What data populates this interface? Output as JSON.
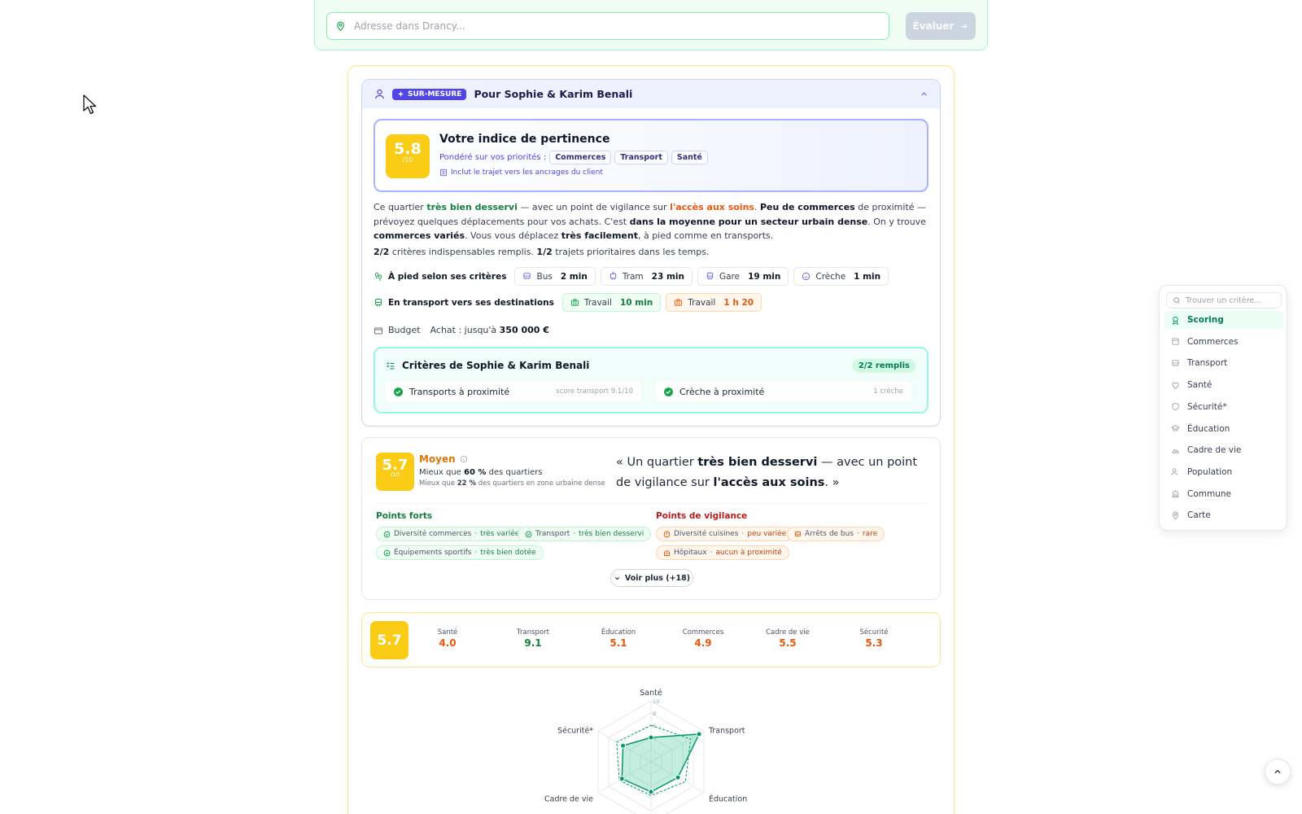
{
  "search": {
    "placeholder": "Adresse dans Drancy...",
    "button_label": "Évaluer"
  },
  "profile": {
    "badge": "SUR-MESURE",
    "title": "Pour Sophie & Karim Benali",
    "score": "5.8",
    "score_max": "/10",
    "index_title": "Votre indice de pertinence",
    "priorities_label": "Pondéré sur vos priorités :",
    "priorities": [
      "Commerces",
      "Transport",
      "Santé"
    ],
    "note": "Inclut le trajet vers les ancrages du client",
    "summary": {
      "p1": "Ce quartier ",
      "b1": "très bien desservi",
      "p2": " — avec un point de vigilance sur ",
      "b2": "l'accès aux soins",
      "p3": ". ",
      "b3": "Peu de commerces",
      "p4": " de proximité — prévoyez quelques déplacements pour vos achats. C'est ",
      "b4": "dans la moyenne pour un secteur urbain dense",
      "p5": ". On y trouve ",
      "b5": "commerces variés",
      "p6": ". Vous vous déplacez ",
      "b6": "très facilement",
      "p7": ", à pied comme en transports."
    },
    "criteria_line": {
      "b1": "2/2",
      "t1": " critères indispensables remplis. ",
      "b2": "1/2",
      "t2": " trajets prioritaires dans les temps."
    },
    "walk_label": "À pied selon ses critères",
    "walk": [
      {
        "icon": "bus-icon",
        "label": "Bus",
        "value": "2 min"
      },
      {
        "icon": "tram-icon",
        "label": "Tram",
        "value": "23 min"
      },
      {
        "icon": "train-icon",
        "label": "Gare",
        "value": "19 min"
      },
      {
        "icon": "baby-icon",
        "label": "Crèche",
        "value": "1 min"
      }
    ],
    "transit_label": "En transport vers ses destinations",
    "transit": [
      {
        "label": "Travail",
        "value": "10 min",
        "status": "green"
      },
      {
        "label": "Travail",
        "value": "1 h 20",
        "status": "orange"
      }
    ],
    "budget_label": "Budget",
    "budget_text": "Achat : jusqu'à ",
    "budget_value": "350 000 €",
    "criteria_title": "Critères de Sophie & Karim Benali",
    "criteria_badge": "2/2 remplis",
    "criteria": [
      {
        "label": "Transports à proximité",
        "meta": "score transport 9.1/10"
      },
      {
        "label": "Crèche à proximité",
        "meta": "1 crèche"
      }
    ]
  },
  "scoring": {
    "score": "5.7",
    "score_max": "/10",
    "level": "Moyen",
    "cmp1_a": "Mieux que ",
    "cmp1_b": "60 %",
    "cmp1_c": " des quartiers",
    "cmp2_a": "Mieux que ",
    "cmp2_b": "22 %",
    "cmp2_c": " des quartiers en zone urbaine dense",
    "quote": {
      "a": "« Un quartier ",
      "b": "très bien desservi",
      "c": " — avec un point de vigilance sur ",
      "d": "l'accès aux soins",
      "e": ". »"
    },
    "strengths_title": "Points forts",
    "strengths": [
      {
        "label": "Diversité commerces",
        "value": "très variée"
      },
      {
        "label": "Transport",
        "value": "très bien desservi"
      },
      {
        "label": "Équipements sportifs",
        "value": "très bien dotée"
      }
    ],
    "vigilance_title": "Points de vigilance",
    "vigilance": [
      {
        "label": "Diversité cuisines",
        "value": "peu variée"
      },
      {
        "label": "Arrêts de bus",
        "value": "rare"
      },
      {
        "label": "Hôpitaux",
        "value": "aucun à proximité"
      }
    ],
    "more_label": "Voir plus (+18)"
  },
  "categories": {
    "score": "5.7",
    "items": [
      {
        "name": "Santé",
        "value": "4.0",
        "color": "#ea580c"
      },
      {
        "name": "Transport",
        "value": "9.1",
        "color": "#15803d"
      },
      {
        "name": "Éducation",
        "value": "5.1",
        "color": "#ea580c"
      },
      {
        "name": "Commerces",
        "value": "4.9",
        "color": "#ea580c"
      },
      {
        "name": "Cadre de vie",
        "value": "5.5",
        "color": "#ea580c"
      },
      {
        "name": "Sécurité",
        "value": "5.3",
        "color": "#ea580c"
      }
    ]
  },
  "radar": {
    "axes": [
      "Santé",
      "Transport",
      "Éducation",
      "",
      "Cadre de vie",
      "Sécurité*"
    ],
    "ticks": [
      "10",
      "8",
      "6",
      "4"
    ],
    "values": [
      4.0,
      9.1,
      5.1,
      4.9,
      5.5,
      5.3
    ],
    "ref_values": [
      6.0,
      7.5,
      6.5,
      5.5,
      6.0,
      6.5
    ],
    "color": "#059669"
  },
  "nav": {
    "search_placeholder": "Trouver un critère...",
    "items": [
      {
        "label": "Scoring",
        "icon": "award-icon",
        "active": true
      },
      {
        "label": "Commerces",
        "icon": "shop-icon",
        "active": false
      },
      {
        "label": "Transport",
        "icon": "bus-icon",
        "active": false
      },
      {
        "label": "Santé",
        "icon": "heart-icon",
        "active": false
      },
      {
        "label": "Sécurité*",
        "icon": "shield-icon",
        "active": false
      },
      {
        "label": "Éducation",
        "icon": "graduation-icon",
        "active": false
      },
      {
        "label": "Cadre de vie",
        "icon": "tree-icon",
        "active": false
      },
      {
        "label": "Population",
        "icon": "users-icon",
        "active": false
      },
      {
        "label": "Commune",
        "icon": "building-icon",
        "active": false
      },
      {
        "label": "Carte",
        "icon": "map-pin-icon",
        "active": false
      }
    ]
  }
}
